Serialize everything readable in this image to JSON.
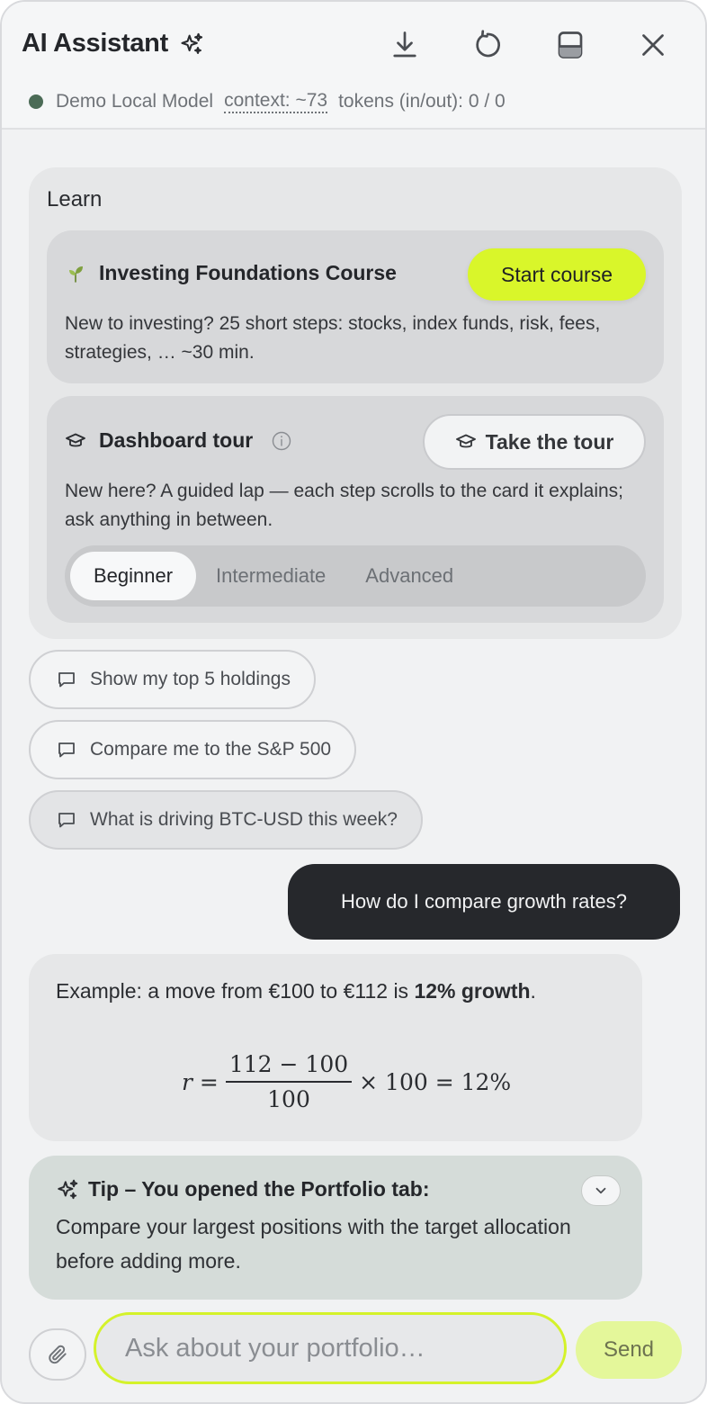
{
  "header": {
    "title": "AI Assistant",
    "title_icon": "sparkles-icon",
    "actions": [
      {
        "name": "download-icon",
        "label": "Download"
      },
      {
        "name": "reset-icon",
        "label": "Reset"
      },
      {
        "name": "dock-layout-icon",
        "label": "Layout"
      },
      {
        "name": "close-icon",
        "label": "Close"
      }
    ],
    "status": {
      "model": "Demo Local Model",
      "context": "context: ~73",
      "tokens": "tokens (in/out): 0 / 0",
      "dot_color": "#4b6b56"
    }
  },
  "learn": {
    "title": "Learn",
    "course": {
      "icon": "seedling-icon",
      "title": "Investing Foundations Course",
      "button": "Start course",
      "description": "New to investing? 25 short steps: stocks, index funds, risk, fees, strategies, … ~30 min."
    },
    "tour": {
      "icon": "graduation-cap-icon",
      "title": "Dashboard tour",
      "button": "Take the tour",
      "description": "New here? A guided lap — each step scrolls to the card it explains; ask anything in between.",
      "levels": [
        "Beginner",
        "Intermediate",
        "Advanced"
      ],
      "selected_level": "Beginner"
    }
  },
  "suggestions": [
    "Show my top 5 holdings",
    "Compare me to the S&P 500",
    "What is driving BTC-USD this week?"
  ],
  "messages": {
    "user": "How do I compare growth rates?",
    "assistant": {
      "text_before": "Example: a move from €100 to €112 is ",
      "text_bold": "12% growth",
      "text_after": ".",
      "formula": {
        "lhs": "r =",
        "numerator": "112 − 100",
        "denominator": "100",
        "rhs": "× 100 = 12%"
      }
    }
  },
  "tip": {
    "title": "Tip – You opened the Portfolio tab:",
    "text": "Compare your largest positions with the target allocation before adding more."
  },
  "composer": {
    "placeholder": "Ask about your portfolio…",
    "send_label": "Send"
  },
  "colors": {
    "accent": "#d9f62a",
    "user_bubble": "#26282c",
    "tip_background": "#d5dcd9"
  }
}
